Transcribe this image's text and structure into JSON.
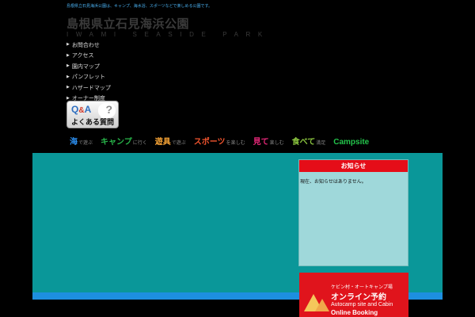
{
  "topbar": {
    "text": "島根県立石見海浜公園は、キャンプ、海水浴、スポーツなどで楽しめる公園です。"
  },
  "logo": {
    "jp": "島根県立石見海浜公園",
    "en": "IWAMI SEASIDE PARK"
  },
  "nav": {
    "items": [
      {
        "label": "お問合わせ"
      },
      {
        "label": "アクセス"
      },
      {
        "label": "園内マップ"
      },
      {
        "label": "パンフレット"
      },
      {
        "label": "ハザードマップ"
      },
      {
        "label": "オーナー制度"
      }
    ]
  },
  "qa": {
    "q": "Q",
    "amp": "&",
    "a": "A",
    "mark": "?",
    "label": "よくある質問"
  },
  "menu": {
    "items": [
      {
        "big": "海",
        "small": "で遊ぶ",
        "color": "#2c8ff0"
      },
      {
        "big": "キャンプ",
        "small": "に行く",
        "color": "#28b64a"
      },
      {
        "big": "遊具",
        "small": "で遊ぶ",
        "color": "#f4a235"
      },
      {
        "big": "スポーツ",
        "small": "を楽しむ",
        "color": "#f2542e"
      },
      {
        "big": "見て",
        "small": "楽しむ",
        "color": "#e8287a"
      },
      {
        "big": "食べて",
        "small": "満足",
        "color": "#8bc53f"
      }
    ],
    "campsite": "Campsite"
  },
  "notice": {
    "title": "お知らせ",
    "body": "現在、お知らせはありません。"
  },
  "booking": {
    "sub": "ケビン村・オートキャンプ場",
    "main": "オンライン予約",
    "en": "Autocamp site and Cabin",
    "en2": "Online Booking"
  }
}
